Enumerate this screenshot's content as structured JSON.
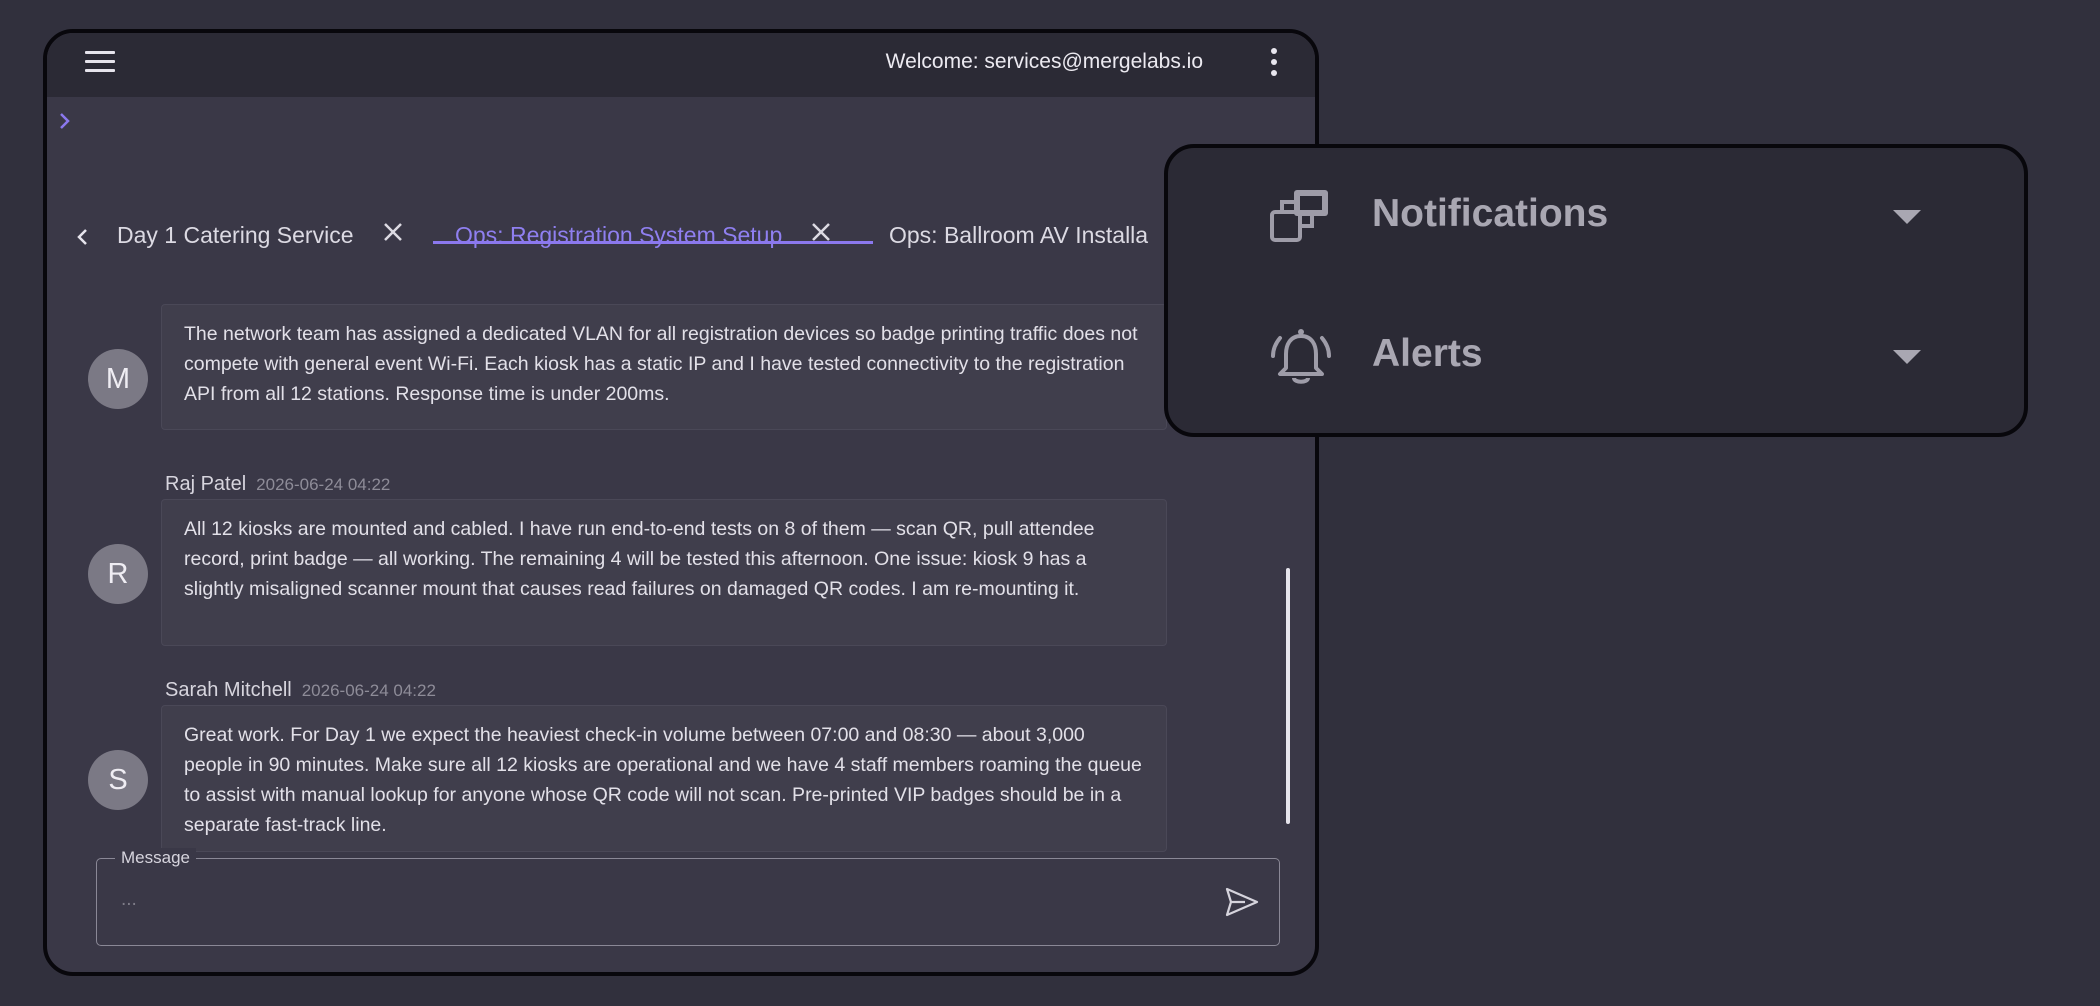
{
  "header": {
    "welcome": "Welcome: services@mergelabs.io"
  },
  "tabs": [
    {
      "label": "Day 1 Catering Service",
      "active": false
    },
    {
      "label": "Ops: Registration System Setup",
      "active": true
    },
    {
      "label": "Ops: Ballroom AV Installa",
      "active": false
    }
  ],
  "messages": [
    {
      "initial": "M",
      "author": "",
      "time": "",
      "text": "The network team has assigned a dedicated VLAN for all registration devices so badge printing traffic does not compete with general event Wi-Fi. Each kiosk has a static IP and I have tested connectivity to the registration API from all 12 stations. Response time is under 200ms."
    },
    {
      "initial": "R",
      "author": "Raj Patel",
      "time": "2026-06-24 04:22",
      "text": "All 12 kiosks are mounted and cabled. I have run end-to-end tests on 8 of them — scan QR, pull attendee record, print badge — all working. The remaining 4 will be tested this afternoon. One issue: kiosk 9 has a slightly misaligned scanner mount that causes read failures on damaged QR codes. I am re-mounting it."
    },
    {
      "initial": "S",
      "author": "Sarah Mitchell",
      "time": "2026-06-24 04:22",
      "text": "Great work. For Day 1 we expect the heaviest check-in volume between 07:00 and 08:30 — about 3,000 people in 90 minutes. Make sure all 12 kiosks are operational and we have 4 staff members roaming the queue to assist with manual lookup for anyone whose QR code will not scan. Pre-printed VIP badges should be in a separate fast-track line."
    }
  ],
  "composer": {
    "label": "Message",
    "placeholder": "..."
  },
  "panel": {
    "items": [
      {
        "label": "Notifications",
        "icon": "stacked-windows-icon"
      },
      {
        "label": "Alerts",
        "icon": "bell-ringing-icon"
      }
    ]
  },
  "colors": {
    "background": "#31303d",
    "window": "#3a3847",
    "topbar": "#2b2a35",
    "accent": "#8b78ee"
  }
}
